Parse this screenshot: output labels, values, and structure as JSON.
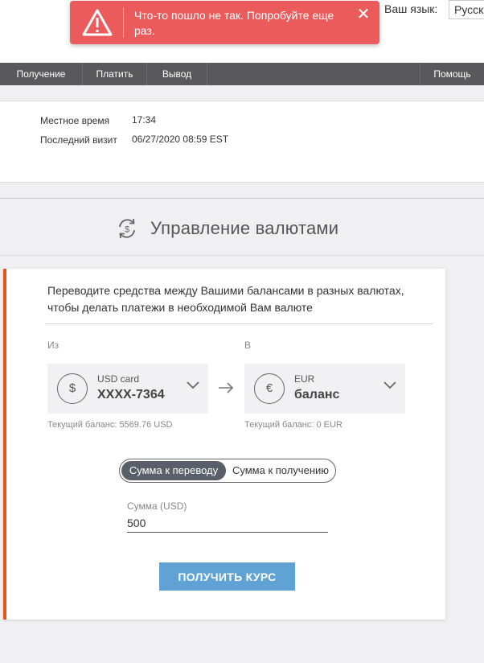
{
  "header": {
    "language_label": "Ваш язык:",
    "language_selected": "Русский"
  },
  "toast": {
    "message": "Что-то пошло не так. Попробуйте еще раз.",
    "icon": "warning-icon",
    "close_symbol": "✕",
    "color": "#ec5b5b"
  },
  "nav": {
    "items": [
      {
        "label": "Получение"
      },
      {
        "label": "Платить"
      },
      {
        "label": "Вывод"
      }
    ],
    "help": "Помощь",
    "color": "#59595b"
  },
  "info": {
    "local_time_label": "Местное время",
    "local_time_value": "17:34",
    "last_visit_label": "Последний визит",
    "last_visit_value": "06/27/2020 08:59 EST"
  },
  "section": {
    "title": "Управление валютами",
    "icon": "currency-exchange-icon"
  },
  "card": {
    "accent_color": "#e8541e",
    "description": "Переводите средства между Вашими балансами в разных валютах, чтобы делать платежи в необходимой Вам валюте",
    "from": {
      "label": "Из",
      "symbol": "$",
      "type": "USD card",
      "number": "XXXX-7364",
      "balance_note": "Текущий баланс: 5569.76 USD"
    },
    "to": {
      "label": "В",
      "symbol": "€",
      "type": "EUR",
      "number": "баланс",
      "balance_note": "Текущий баланс: 0 EUR"
    },
    "toggle": {
      "active": "Сумма к переводу",
      "inactive": "Сумма к получению"
    },
    "amount": {
      "label": "Сумма (USD)",
      "value": "500"
    },
    "button_label": "ПОЛУЧИТЬ КУРС",
    "button_color": "#5fa2d3"
  }
}
